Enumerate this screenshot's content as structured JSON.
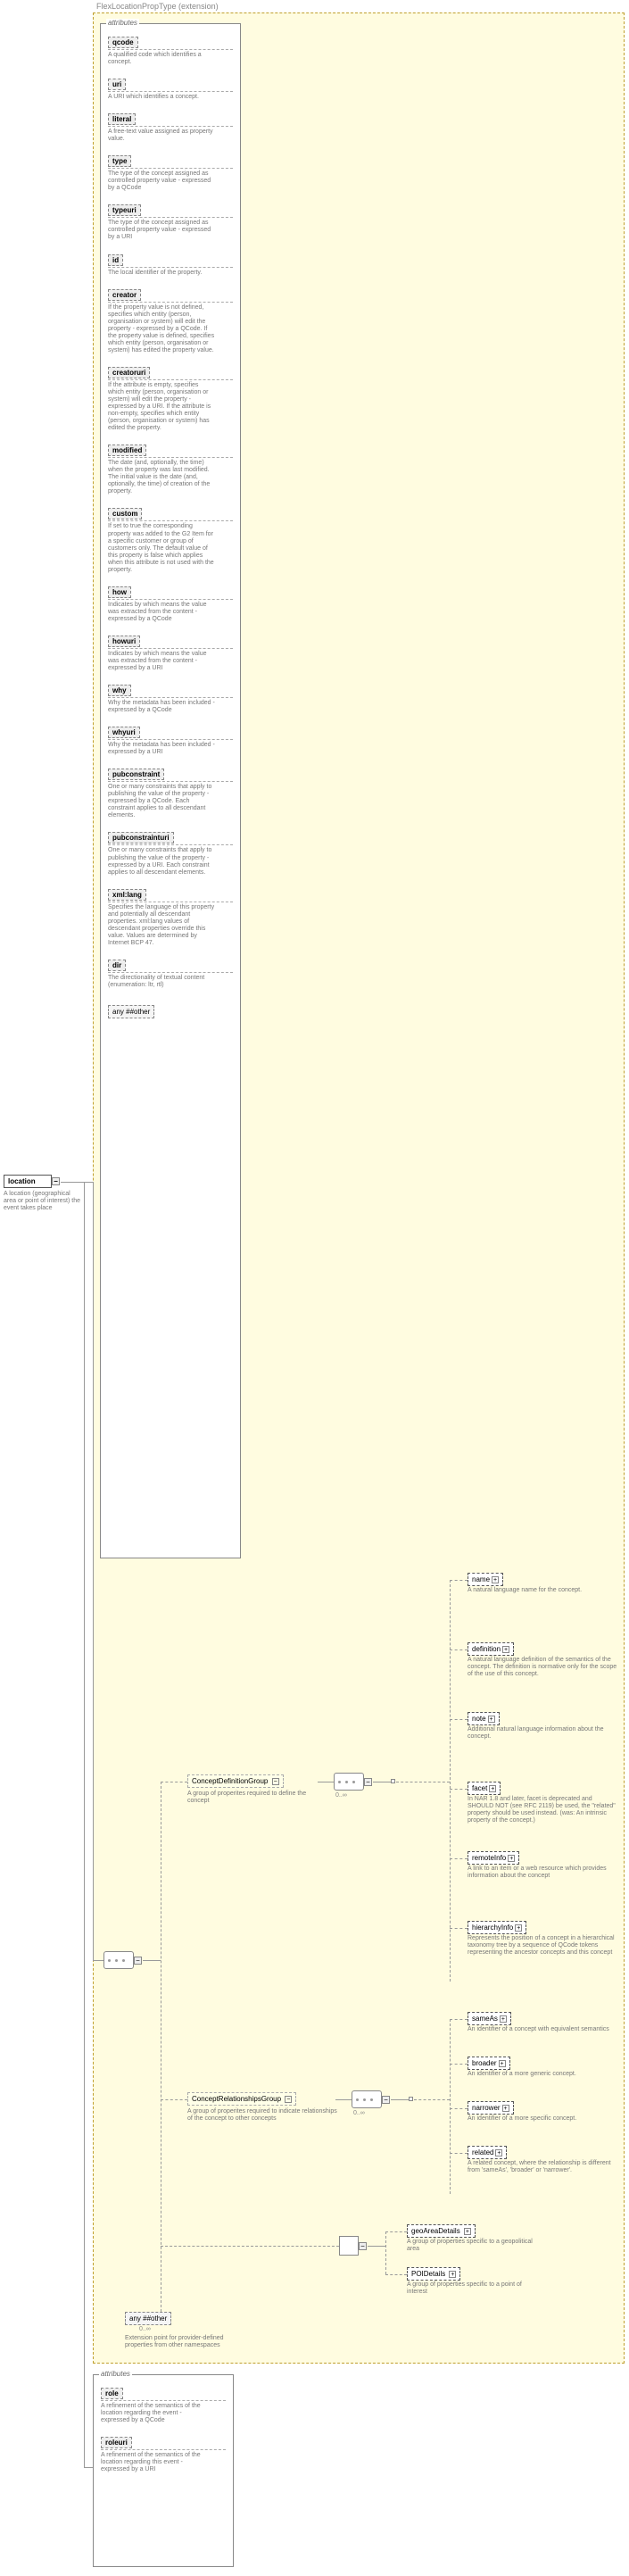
{
  "extension_label": "FlexLocationPropType (extension)",
  "root": {
    "name": "location",
    "desc": "A location (geographical area or point of interest) the event takes place"
  },
  "attr_panel1_title": "attributes",
  "attrs1": [
    {
      "name": "qcode",
      "desc": "A qualified code which identifies a concept."
    },
    {
      "name": "uri",
      "desc": "A URI which identifies a concept."
    },
    {
      "name": "literal",
      "desc": "A free-text value assigned as property value."
    },
    {
      "name": "type",
      "desc": "The type of the concept assigned as controlled property value - expressed by a QCode"
    },
    {
      "name": "typeuri",
      "desc": "The type of the concept assigned as controlled property value - expressed by a URI"
    },
    {
      "name": "id",
      "desc": "The local identifier of the property."
    },
    {
      "name": "creator",
      "desc": "If the property value is not defined, specifies which entity (person, organisation or system) will edit the property - expressed by a QCode. If the property value is defined, specifies which entity (person, organisation or system) has edited the property value."
    },
    {
      "name": "creatoruri",
      "desc": "If the attribute is empty, specifies which entity (person, organisation or system) will edit the property - expressed by a URI. If the attribute is non-empty, specifies which entity (person, organisation or system) has edited the property."
    },
    {
      "name": "modified",
      "desc": "The date (and, optionally, the time) when the property was last modified. The initial value is the date (and, optionally, the time) of creation of the property."
    },
    {
      "name": "custom",
      "desc": "If set to true the corresponding property was added to the G2 Item for a specific customer or group of customers only. The default value of this property is false which applies when this attribute is not used with the property."
    },
    {
      "name": "how",
      "desc": "Indicates by which means the value was extracted from the content - expressed by a QCode"
    },
    {
      "name": "howuri",
      "desc": "Indicates by which means the value was extracted from the content - expressed by a URI"
    },
    {
      "name": "why",
      "desc": "Why the metadata has been included - expressed by a QCode"
    },
    {
      "name": "whyuri",
      "desc": "Why the metadata has been included - expressed by a URI"
    },
    {
      "name": "pubconstraint",
      "desc": "One or many constraints that apply to publishing the value of the property - expressed by a QCode. Each constraint applies to all descendant elements."
    },
    {
      "name": "pubconstrainturi",
      "desc": "One or many constraints that apply to publishing the value of the property - expressed by a URI. Each constraint applies to all descendant elements."
    },
    {
      "name": "xml:lang",
      "desc": "Specifies the language of this property and potentially all descendant properties. xml:lang values of descendant properties override this value. Values are determined by Internet BCP 47."
    },
    {
      "name": "dir",
      "desc": "The directionality of textual content (enumeration: ltr, rtl)"
    }
  ],
  "any_attr": "any ##other",
  "cdg": {
    "name": "ConceptDefinitionGroup",
    "desc": "A group of properites required to define the concept",
    "mult": "0..∞"
  },
  "cdg_children": [
    {
      "name": "name",
      "desc": "A natural language name for the concept."
    },
    {
      "name": "definition",
      "desc": "A natural language definition of the semantics of the concept. The definition is normative only for the scope of the use of this concept."
    },
    {
      "name": "note",
      "desc": "Additional natural language information about the concept."
    },
    {
      "name": "facet",
      "desc": "In NAR 1.8 and later, facet is deprecated and SHOULD NOT (see RFC 2119) be used, the \"related\" property should be used instead. (was: An intrinsic property of the concept.)"
    },
    {
      "name": "remoteInfo",
      "desc": "A link to an item or a web resource which provides information about the concept"
    },
    {
      "name": "hierarchyInfo",
      "desc": "Represents the position of a concept in a hierarchical taxonomy tree by a sequence of QCode tokens representing the ancestor concepts and this concept"
    }
  ],
  "crg": {
    "name": "ConceptRelationshipsGroup",
    "desc": "A group of properites required to indicate relationships of the concept to other concepts",
    "mult": "0..∞"
  },
  "crg_children": [
    {
      "name": "sameAs",
      "desc": "An identifier of a concept with equivalent semantics"
    },
    {
      "name": "broader",
      "desc": "An identifier of a more generic concept."
    },
    {
      "name": "narrower",
      "desc": "An identifier of a more specific concept."
    },
    {
      "name": "related",
      "desc": "A related concept, where the relationship is different from 'sameAs', 'broader' or 'narrower'."
    }
  ],
  "geo": {
    "name": "geoAreaDetails",
    "desc": "A group of properties specific to a geopolitical area"
  },
  "poi": {
    "name": "POIDetails",
    "desc": "A group of properties specific to a point of interest"
  },
  "any_elem": {
    "name": "any ##other",
    "desc": "Extension point for provider-defined properties from other namespaces",
    "mult": "0..∞"
  },
  "attr_panel2_title": "attributes",
  "attrs2": [
    {
      "name": "role",
      "desc": "A refinement of the semantics of the location regarding the event - expressed by a QCode"
    },
    {
      "name": "roleuri",
      "desc": "A refinement of the semantics of the location regarding this event - expressed by a URI"
    }
  ],
  "plus": "+",
  "minus": "−"
}
